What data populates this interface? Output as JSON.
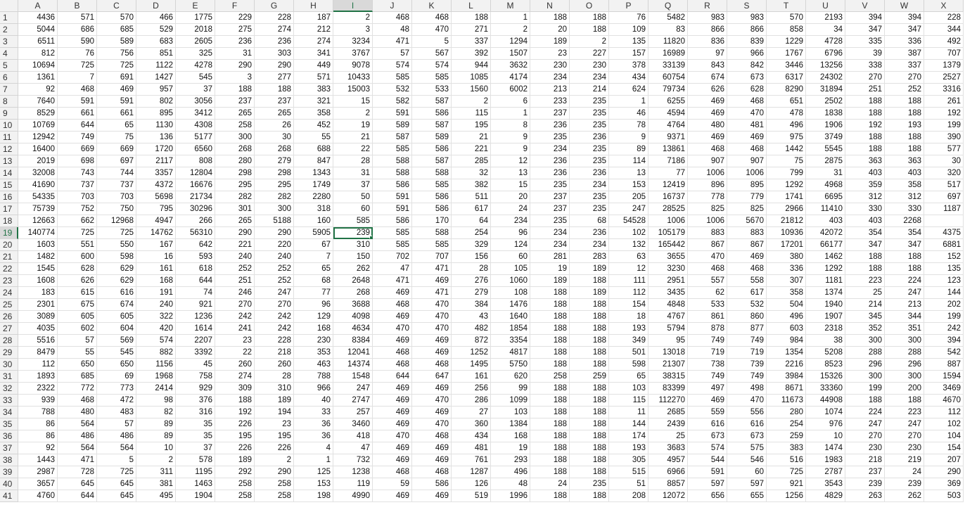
{
  "sheet": {
    "columns": [
      "A",
      "B",
      "C",
      "D",
      "E",
      "F",
      "G",
      "H",
      "I",
      "J",
      "K",
      "L",
      "M",
      "N",
      "O",
      "P",
      "Q",
      "R",
      "S",
      "T",
      "U",
      "V",
      "W",
      "X"
    ],
    "active_cell": {
      "row": 19,
      "col": "I"
    },
    "row_numbers": [
      "1",
      "2",
      "3",
      "4",
      "5",
      "6",
      "7",
      "8",
      "9",
      "10",
      "11",
      "12",
      "13",
      "14",
      "15",
      "16",
      "17",
      "18",
      "19",
      "20",
      "21",
      "22",
      "23",
      "24",
      "25",
      "26",
      "27",
      "28",
      "29",
      "30",
      "31",
      "32",
      "33",
      "34",
      "35",
      "36",
      "37",
      "38",
      "39",
      "40",
      "41"
    ],
    "rows": [
      [
        "4436",
        "571",
        "570",
        "466",
        "1775",
        "229",
        "228",
        "187",
        "2",
        "468",
        "468",
        "188",
        "1",
        "188",
        "188",
        "76",
        "5482",
        "983",
        "983",
        "570",
        "2193",
        "394",
        "394",
        "228"
      ],
      [
        "5044",
        "686",
        "685",
        "529",
        "2018",
        "275",
        "274",
        "212",
        "3",
        "48",
        "470",
        "271",
        "2",
        "20",
        "188",
        "109",
        "83",
        "866",
        "866",
        "858",
        "34",
        "347",
        "347",
        "344"
      ],
      [
        "6511",
        "590",
        "589",
        "683",
        "2605",
        "236",
        "236",
        "274",
        "3234",
        "471",
        "5",
        "337",
        "1294",
        "189",
        "2",
        "135",
        "11820",
        "836",
        "839",
        "1229",
        "4728",
        "335",
        "336",
        "492"
      ],
      [
        "812",
        "76",
        "756",
        "851",
        "325",
        "31",
        "303",
        "341",
        "3767",
        "57",
        "567",
        "392",
        "1507",
        "23",
        "227",
        "157",
        "16989",
        "97",
        "966",
        "1767",
        "6796",
        "39",
        "387",
        "707"
      ],
      [
        "10694",
        "725",
        "725",
        "1122",
        "4278",
        "290",
        "290",
        "449",
        "9078",
        "574",
        "574",
        "944",
        "3632",
        "230",
        "230",
        "378",
        "33139",
        "843",
        "842",
        "3446",
        "13256",
        "338",
        "337",
        "1379"
      ],
      [
        "1361",
        "7",
        "691",
        "1427",
        "545",
        "3",
        "277",
        "571",
        "10433",
        "585",
        "585",
        "1085",
        "4174",
        "234",
        "234",
        "434",
        "60754",
        "674",
        "673",
        "6317",
        "24302",
        "270",
        "270",
        "2527"
      ],
      [
        "92",
        "468",
        "469",
        "957",
        "37",
        "188",
        "188",
        "383",
        "15003",
        "532",
        "533",
        "1560",
        "6002",
        "213",
        "214",
        "624",
        "79734",
        "626",
        "628",
        "8290",
        "31894",
        "251",
        "252",
        "3316"
      ],
      [
        "7640",
        "591",
        "591",
        "802",
        "3056",
        "237",
        "237",
        "321",
        "15",
        "582",
        "587",
        "2",
        "6",
        "233",
        "235",
        "1",
        "6255",
        "469",
        "468",
        "651",
        "2502",
        "188",
        "188",
        "261"
      ],
      [
        "8529",
        "661",
        "661",
        "895",
        "3412",
        "265",
        "265",
        "358",
        "2",
        "591",
        "586",
        "115",
        "1",
        "237",
        "235",
        "46",
        "4594",
        "469",
        "470",
        "478",
        "1838",
        "188",
        "188",
        "192"
      ],
      [
        "10769",
        "644",
        "65",
        "1130",
        "4308",
        "258",
        "26",
        "452",
        "19",
        "589",
        "587",
        "195",
        "8",
        "236",
        "235",
        "78",
        "4764",
        "480",
        "481",
        "496",
        "1906",
        "192",
        "193",
        "199"
      ],
      [
        "12942",
        "749",
        "75",
        "136",
        "5177",
        "300",
        "30",
        "55",
        "21",
        "587",
        "589",
        "21",
        "9",
        "235",
        "236",
        "9",
        "9371",
        "469",
        "469",
        "975",
        "3749",
        "188",
        "188",
        "390"
      ],
      [
        "16400",
        "669",
        "669",
        "1720",
        "6560",
        "268",
        "268",
        "688",
        "22",
        "585",
        "586",
        "221",
        "9",
        "234",
        "235",
        "89",
        "13861",
        "468",
        "468",
        "1442",
        "5545",
        "188",
        "188",
        "577"
      ],
      [
        "2019",
        "698",
        "697",
        "2117",
        "808",
        "280",
        "279",
        "847",
        "28",
        "588",
        "587",
        "285",
        "12",
        "236",
        "235",
        "114",
        "7186",
        "907",
        "907",
        "75",
        "2875",
        "363",
        "363",
        "30"
      ],
      [
        "32008",
        "743",
        "744",
        "3357",
        "12804",
        "298",
        "298",
        "1343",
        "31",
        "588",
        "588",
        "32",
        "13",
        "236",
        "236",
        "13",
        "77",
        "1006",
        "1006",
        "799",
        "31",
        "403",
        "403",
        "320"
      ],
      [
        "41690",
        "737",
        "737",
        "4372",
        "16676",
        "295",
        "295",
        "1749",
        "37",
        "586",
        "585",
        "382",
        "15",
        "235",
        "234",
        "153",
        "12419",
        "896",
        "895",
        "1292",
        "4968",
        "359",
        "358",
        "517"
      ],
      [
        "54335",
        "703",
        "703",
        "5698",
        "21734",
        "282",
        "282",
        "2280",
        "50",
        "591",
        "586",
        "511",
        "20",
        "237",
        "235",
        "205",
        "16737",
        "778",
        "779",
        "1741",
        "6695",
        "312",
        "312",
        "697"
      ],
      [
        "75739",
        "752",
        "750",
        "795",
        "30296",
        "301",
        "300",
        "318",
        "60",
        "591",
        "586",
        "617",
        "24",
        "237",
        "235",
        "247",
        "28525",
        "825",
        "825",
        "2966",
        "11410",
        "330",
        "330",
        "1187"
      ],
      [
        "12663",
        "662",
        "12968",
        "4947",
        "266",
        "265",
        "5188",
        "160",
        "585",
        "586",
        "170",
        "64",
        "234",
        "235",
        "68",
        "54528",
        "1006",
        "1006",
        "5670",
        "21812",
        "403",
        "403",
        "2268",
        ""
      ],
      [
        "140774",
        "725",
        "725",
        "14762",
        "56310",
        "290",
        "290",
        "5905",
        "239",
        "585",
        "588",
        "254",
        "96",
        "234",
        "236",
        "102",
        "105179",
        "883",
        "883",
        "10936",
        "42072",
        "354",
        "354",
        "4375"
      ],
      [
        "1603",
        "551",
        "550",
        "167",
        "642",
        "221",
        "220",
        "67",
        "310",
        "585",
        "585",
        "329",
        "124",
        "234",
        "234",
        "132",
        "165442",
        "867",
        "867",
        "17201",
        "66177",
        "347",
        "347",
        "6881"
      ],
      [
        "1482",
        "600",
        "598",
        "16",
        "593",
        "240",
        "240",
        "7",
        "150",
        "702",
        "707",
        "156",
        "60",
        "281",
        "283",
        "63",
        "3655",
        "470",
        "469",
        "380",
        "1462",
        "188",
        "188",
        "152"
      ],
      [
        "1545",
        "628",
        "629",
        "161",
        "618",
        "252",
        "252",
        "65",
        "262",
        "47",
        "471",
        "28",
        "105",
        "19",
        "189",
        "12",
        "3230",
        "468",
        "468",
        "336",
        "1292",
        "188",
        "188",
        "135"
      ],
      [
        "1608",
        "626",
        "629",
        "168",
        "644",
        "251",
        "252",
        "68",
        "2648",
        "471",
        "469",
        "276",
        "1060",
        "189",
        "188",
        "111",
        "2951",
        "557",
        "558",
        "307",
        "1181",
        "223",
        "224",
        "123"
      ],
      [
        "183",
        "615",
        "616",
        "191",
        "74",
        "246",
        "247",
        "77",
        "268",
        "469",
        "471",
        "279",
        "108",
        "188",
        "189",
        "112",
        "3435",
        "62",
        "617",
        "358",
        "1374",
        "25",
        "247",
        "144"
      ],
      [
        "2301",
        "675",
        "674",
        "240",
        "921",
        "270",
        "270",
        "96",
        "3688",
        "468",
        "470",
        "384",
        "1476",
        "188",
        "188",
        "154",
        "4848",
        "533",
        "532",
        "504",
        "1940",
        "214",
        "213",
        "202"
      ],
      [
        "3089",
        "605",
        "605",
        "322",
        "1236",
        "242",
        "242",
        "129",
        "4098",
        "469",
        "470",
        "43",
        "1640",
        "188",
        "188",
        "18",
        "4767",
        "861",
        "860",
        "496",
        "1907",
        "345",
        "344",
        "199"
      ],
      [
        "4035",
        "602",
        "604",
        "420",
        "1614",
        "241",
        "242",
        "168",
        "4634",
        "470",
        "470",
        "482",
        "1854",
        "188",
        "188",
        "193",
        "5794",
        "878",
        "877",
        "603",
        "2318",
        "352",
        "351",
        "242"
      ],
      [
        "5516",
        "57",
        "569",
        "574",
        "2207",
        "23",
        "228",
        "230",
        "8384",
        "469",
        "469",
        "872",
        "3354",
        "188",
        "188",
        "349",
        "95",
        "749",
        "749",
        "984",
        "38",
        "300",
        "300",
        "394"
      ],
      [
        "8479",
        "55",
        "545",
        "882",
        "3392",
        "22",
        "218",
        "353",
        "12041",
        "468",
        "469",
        "1252",
        "4817",
        "188",
        "188",
        "501",
        "13018",
        "719",
        "719",
        "1354",
        "5208",
        "288",
        "288",
        "542"
      ],
      [
        "112",
        "650",
        "650",
        "1156",
        "45",
        "260",
        "260",
        "463",
        "14374",
        "468",
        "468",
        "1495",
        "5750",
        "188",
        "188",
        "598",
        "21307",
        "738",
        "739",
        "2216",
        "8523",
        "296",
        "296",
        "887"
      ],
      [
        "1893",
        "685",
        "69",
        "1968",
        "758",
        "274",
        "28",
        "788",
        "1548",
        "644",
        "647",
        "161",
        "620",
        "258",
        "259",
        "65",
        "38315",
        "749",
        "749",
        "3984",
        "15326",
        "300",
        "300",
        "1594"
      ],
      [
        "2322",
        "772",
        "773",
        "2414",
        "929",
        "309",
        "310",
        "966",
        "247",
        "469",
        "469",
        "256",
        "99",
        "188",
        "188",
        "103",
        "83399",
        "497",
        "498",
        "8671",
        "33360",
        "199",
        "200",
        "3469"
      ],
      [
        "939",
        "468",
        "472",
        "98",
        "376",
        "188",
        "189",
        "40",
        "2747",
        "469",
        "470",
        "286",
        "1099",
        "188",
        "188",
        "115",
        "112270",
        "469",
        "470",
        "11673",
        "44908",
        "188",
        "188",
        "4670"
      ],
      [
        "788",
        "480",
        "483",
        "82",
        "316",
        "192",
        "194",
        "33",
        "257",
        "469",
        "469",
        "27",
        "103",
        "188",
        "188",
        "11",
        "2685",
        "559",
        "556",
        "280",
        "1074",
        "224",
        "223",
        "112"
      ],
      [
        "86",
        "564",
        "57",
        "89",
        "35",
        "226",
        "23",
        "36",
        "3460",
        "469",
        "470",
        "360",
        "1384",
        "188",
        "188",
        "144",
        "2439",
        "616",
        "616",
        "254",
        "976",
        "247",
        "247",
        "102"
      ],
      [
        "86",
        "486",
        "486",
        "89",
        "35",
        "195",
        "195",
        "36",
        "418",
        "470",
        "468",
        "434",
        "168",
        "188",
        "188",
        "174",
        "25",
        "673",
        "673",
        "259",
        "10",
        "270",
        "270",
        "104"
      ],
      [
        "92",
        "564",
        "564",
        "10",
        "37",
        "226",
        "226",
        "4",
        "47",
        "469",
        "469",
        "481",
        "19",
        "188",
        "188",
        "193",
        "3683",
        "574",
        "575",
        "383",
        "1474",
        "230",
        "230",
        "154"
      ],
      [
        "1443",
        "471",
        "5",
        "2",
        "578",
        "189",
        "2",
        "1",
        "732",
        "469",
        "469",
        "761",
        "293",
        "188",
        "188",
        "305",
        "4957",
        "544",
        "546",
        "516",
        "1983",
        "218",
        "219",
        "207"
      ],
      [
        "2987",
        "728",
        "725",
        "311",
        "1195",
        "292",
        "290",
        "125",
        "1238",
        "468",
        "468",
        "1287",
        "496",
        "188",
        "188",
        "515",
        "6966",
        "591",
        "60",
        "725",
        "2787",
        "237",
        "24",
        "290"
      ],
      [
        "3657",
        "645",
        "645",
        "381",
        "1463",
        "258",
        "258",
        "153",
        "119",
        "59",
        "586",
        "126",
        "48",
        "24",
        "235",
        "51",
        "8857",
        "597",
        "597",
        "921",
        "3543",
        "239",
        "239",
        "369"
      ],
      [
        "4760",
        "644",
        "645",
        "495",
        "1904",
        "258",
        "258",
        "198",
        "4990",
        "469",
        "469",
        "519",
        "1996",
        "188",
        "188",
        "208",
        "12072",
        "656",
        "655",
        "1256",
        "4829",
        "263",
        "262",
        "503"
      ]
    ]
  }
}
